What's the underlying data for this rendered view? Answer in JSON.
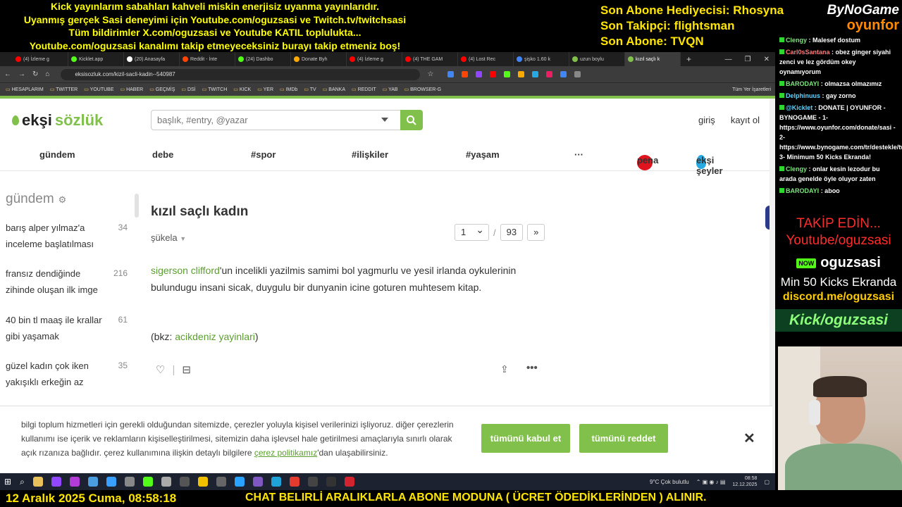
{
  "overlay": {
    "marquee_lines": [
      "Kick yayınlarım sabahları kahveli miskin enerjisiz uyanma yayınlarıdır.",
      "Uyanmış gerçek Sasi deneyimi için Youtube.com/oguzsasi ve Twitch.tv/twitchsasi",
      "Tüm bildirimler X.com/oguzsasi ve Youtube KATIL toplulukta...",
      "Youtube.com/oguzsasi kanalımı takip etmeyeceksiniz burayı takip etmeniz boş!"
    ],
    "sub_info": [
      "Son Abone Hediyecisi: Rhosyna",
      "Son Takipçi: flightsman",
      "Son Abone: TVQN"
    ],
    "brand_top": "ByNoGame",
    "brand_bottom": "oyunfor"
  },
  "browser": {
    "tabs": [
      {
        "label": "(4) İzleme g",
        "color": "#ff0000"
      },
      {
        "label": "Kicklet.app",
        "color": "#53fc18"
      },
      {
        "label": "(20) Anasayfa",
        "color": "#ffffff"
      },
      {
        "label": "Reddit - İnte",
        "color": "#ff4500"
      },
      {
        "label": "(24) Dashbo",
        "color": "#53fc18"
      },
      {
        "label": "Donate Byh",
        "color": "#ffaa00"
      },
      {
        "label": "(4) İzleme g",
        "color": "#ff0000"
      },
      {
        "label": "(4) THE GAM",
        "color": "#ff0000"
      },
      {
        "label": "(4) Lost Rec",
        "color": "#ff0000"
      },
      {
        "label": "şişko 1.60 k",
        "color": "#4285f4"
      },
      {
        "label": "uzun boylu",
        "color": "#81c14b"
      },
      {
        "label": "kızıl saçlı k",
        "color": "#81c14b",
        "active": true
      }
    ],
    "url": "eksisozluk.com/kizil-sacli-kadin--540987",
    "bookmarks": [
      "HESAPLARIM",
      "TWITTER",
      "YOUTUBE",
      "HABER",
      "GEÇMİŞ",
      "DSİ",
      "TWITCH",
      "KICK",
      "YER",
      "IMDb",
      "TV",
      "BANKA",
      "REDDIT",
      "YAB",
      "BROWSER-G"
    ],
    "bookmarks_right": "Tüm Yer İşaretleri"
  },
  "site": {
    "logo_a": "ekşi",
    "logo_b": "sözlük",
    "search_placeholder": "başlık, #entry, @yazar",
    "login": "giriş",
    "register": "kayıt ol",
    "nav": [
      "gündem",
      "debe",
      "#spor",
      "#ilişkiler",
      "#yaşam",
      "···"
    ],
    "pena": "pena",
    "seyler": "ekşi şeyler"
  },
  "sidebar": {
    "title": "gündem",
    "topics": [
      {
        "title": "barış alper yılmaz'a inceleme başlatılması",
        "count": "34"
      },
      {
        "title": "fransız dendiğinde zihinde oluşan ilk imge",
        "count": "216"
      },
      {
        "title": "40 bin tl maaş ile krallar gibi yaşamak",
        "count": "61"
      },
      {
        "title": "güzel kadın çok iken yakışıklı erkeğin az",
        "count": "35"
      }
    ]
  },
  "topic": {
    "title": "kızıl saçlı kadın",
    "sort": "şükela",
    "page_current": "1",
    "page_sep": "/",
    "page_total": "93",
    "page_next": "»",
    "entry_link": "sigerson clifford",
    "entry_text": "'un incelikli yazilmis samimi bol yagmurlu ve yesil irlanda oykulerinin bulundugu insani sicak, duygulu bir dunyanin icine goturen muhtesem kitap.",
    "bkz_prefix": "(bkz: ",
    "bkz_link": "acikdeniz yayinlari",
    "bkz_suffix": ")"
  },
  "cookie": {
    "text_before": "bilgi toplum hizmetleri için gerekli olduğundan sitemizde, çerezler yoluyla kişisel verilerinizi işliyoruz. diğer çerezlerin kullanımı ise içerik ve reklamların kişiselleştirilmesi, sitemizin daha işlevsel hale getirilmesi amaçlarıyla sınırlı olarak açık rızanıza bağlıdır. çerez kullanımına ilişkin detaylı bilgilere ",
    "link": "çerez politikamız",
    "text_after": "'dan ulaşabilirsiniz.",
    "accept": "tümünü kabul et",
    "reject": "tümünü reddet"
  },
  "taskbar": {
    "weather": "9°C  Çok bulutlu",
    "time": "08:58",
    "date": "12.12.2025"
  },
  "bottom": {
    "date_line": "12 Aralık 2025 Cuma, 08:58:18",
    "ticker": "CHAT BELIRLİ ARALIKLARLA ABONE MODUNA ( ÜCRET ÖDEDİKLERİNDEN ) ALINIR."
  },
  "chat": [
    {
      "user": "Clengy",
      "text": " : Malesef dostum"
    },
    {
      "user": "Carl0sSantana",
      "text": " : obez ginger siyahi zenci ve lez gördüm okey oynamıyorum"
    },
    {
      "user": "BARODAYI",
      "text": " : olmazsa olmazımız"
    },
    {
      "user": "Delphinuus",
      "text": " : gay zorno"
    },
    {
      "user": "@Kicklet",
      "text": " : DONATE | OYUNFOR - BYNOGAME - 1- https://www.oyunfor.com/donate/sasi - 2- https://www.bynogame.com/tr/destekle/twitchsasi 3- Minimum 50 Kicks Ekranda!"
    },
    {
      "user": "Clengy",
      "text": " : onlar kesin lezodur bu arada genelde öyle oluyor zaten"
    },
    {
      "user": "BARODAYI",
      "text": " : aboo"
    }
  ],
  "promo": {
    "line1": "TAKİP EDİN...",
    "line2": "Youtube/oguzsasi",
    "kick_badge": "NOW",
    "line3": "oguzsasi",
    "line4": "Min 50 Kicks Ekranda",
    "line5": "discord.me/oguzsasi",
    "line6": "Kick/oguzsasi"
  }
}
